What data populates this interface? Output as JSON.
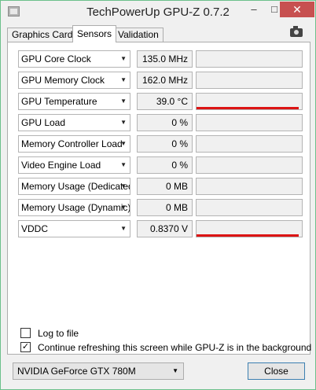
{
  "window": {
    "title": "TechPowerUp GPU-Z 0.7.2",
    "controls": {
      "minimize": "–",
      "maximize": "□",
      "close": "✕"
    }
  },
  "tabs": [
    {
      "label": "Graphics Card",
      "active": false
    },
    {
      "label": "Sensors",
      "active": true
    },
    {
      "label": "Validation",
      "active": false
    }
  ],
  "sensors": [
    {
      "name": "GPU Core Clock",
      "value": "135.0 MHz",
      "graph_level": 0
    },
    {
      "name": "GPU Memory Clock",
      "value": "162.0 MHz",
      "graph_level": 0
    },
    {
      "name": "GPU Temperature",
      "value": "39.0 °C",
      "graph_level": 0.97
    },
    {
      "name": "GPU Load",
      "value": "0 %",
      "graph_level": 0
    },
    {
      "name": "Memory Controller Load",
      "value": "0 %",
      "graph_level": 0
    },
    {
      "name": "Video Engine Load",
      "value": "0 %",
      "graph_level": 0
    },
    {
      "name": "Memory Usage (Dedicated)",
      "value": "0 MB",
      "graph_level": 0
    },
    {
      "name": "Memory Usage (Dynamic)",
      "value": "0 MB",
      "graph_level": 0
    },
    {
      "name": "VDDC",
      "value": "0.8370 V",
      "graph_level": 0.97
    }
  ],
  "options": {
    "log_to_file": {
      "label": "Log to file",
      "checked": false
    },
    "continue_refresh": {
      "label": "Continue refreshing this screen while GPU-Z is in the background",
      "checked": true
    }
  },
  "footer": {
    "gpu_select": "NVIDIA GeForce GTX 780M",
    "close_label": "Close"
  },
  "colors": {
    "graph_bar": "#dc1414",
    "border_accent": "#6cc08c"
  }
}
